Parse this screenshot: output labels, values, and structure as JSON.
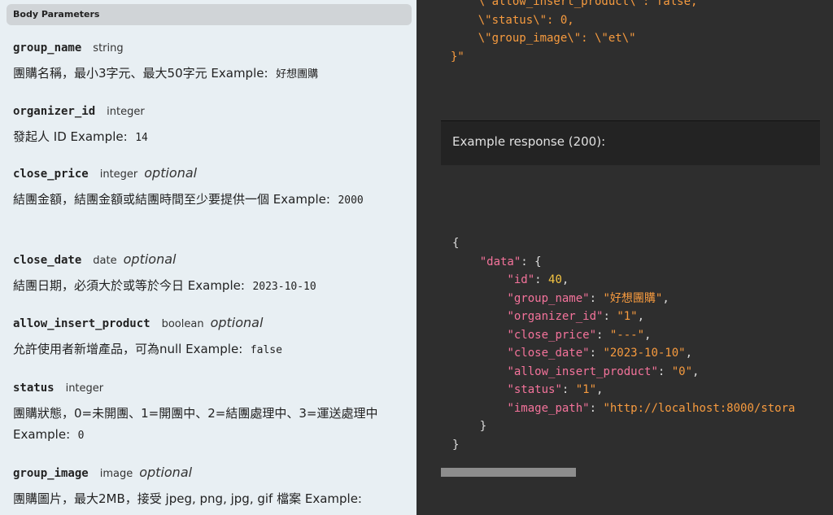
{
  "body_params": {
    "header": "Body Parameters",
    "example_label": "Example:",
    "params": [
      {
        "name": "group_name",
        "type": "string",
        "optional": "",
        "desc": "團購名稱，最小3字元、最大50字元",
        "example": "好想團購"
      },
      {
        "name": "organizer_id",
        "type": "integer",
        "optional": "",
        "desc": "發起人 ID",
        "example": "14"
      },
      {
        "name": "close_price",
        "type": "integer",
        "optional": "optional",
        "desc": "結團金額，結團金額或結團時間至少要提供一個",
        "example": "2000"
      },
      {
        "name": "close_date",
        "type": "date",
        "optional": "optional",
        "desc": "結團日期，必須大於或等於今日",
        "example": "2023-10-10"
      },
      {
        "name": "allow_insert_product",
        "type": "boolean",
        "optional": "optional",
        "desc": "允許使用者新增產品，可為null",
        "example": "false"
      },
      {
        "name": "status",
        "type": "integer",
        "optional": "",
        "desc": "團購狀態，0=未開團、1=開團中、2=結團處理中、3=運送處理中",
        "example": "0"
      },
      {
        "name": "group_image",
        "type": "image",
        "optional": "optional",
        "desc": "團購圖片，最大2MB，接受 jpeg, png, jpg, gif 檔案",
        "example": ""
      }
    ]
  },
  "request_code_tail": {
    "line1": "    \\\"allow_insert_product\\\": false,",
    "line2": "    \\\"status\\\": 0,",
    "line3": "    \\\"group_image\\\": \\\"et\\\"",
    "line4": "}\""
  },
  "response": {
    "title": "Example response (200):",
    "open_brace": "{",
    "data_key": "\"data\"",
    "data_open": "{",
    "fields": [
      {
        "key": "\"id\"",
        "value": "40",
        "kind": "number",
        "comma": ","
      },
      {
        "key": "\"group_name\"",
        "value": "\"好想團購\"",
        "kind": "string",
        "comma": ","
      },
      {
        "key": "\"organizer_id\"",
        "value": "\"1\"",
        "kind": "string",
        "comma": ","
      },
      {
        "key": "\"close_price\"",
        "value": "\"---\"",
        "kind": "string",
        "comma": ","
      },
      {
        "key": "\"close_date\"",
        "value": "\"2023-10-10\"",
        "kind": "string",
        "comma": ","
      },
      {
        "key": "\"allow_insert_product\"",
        "value": "\"0\"",
        "kind": "string",
        "comma": ","
      },
      {
        "key": "\"status\"",
        "value": "\"1\"",
        "kind": "string",
        "comma": ","
      },
      {
        "key": "\"image_path\"",
        "value": "\"http://localhost:8000/stora",
        "kind": "string",
        "comma": ""
      }
    ],
    "data_close": "}",
    "close_brace": "}"
  },
  "colors": {
    "key": "#f4739b",
    "string": "#f79b3f",
    "number": "#f5c542",
    "left_bg": "#e8eff3",
    "right_bg": "#2e2e2e"
  }
}
